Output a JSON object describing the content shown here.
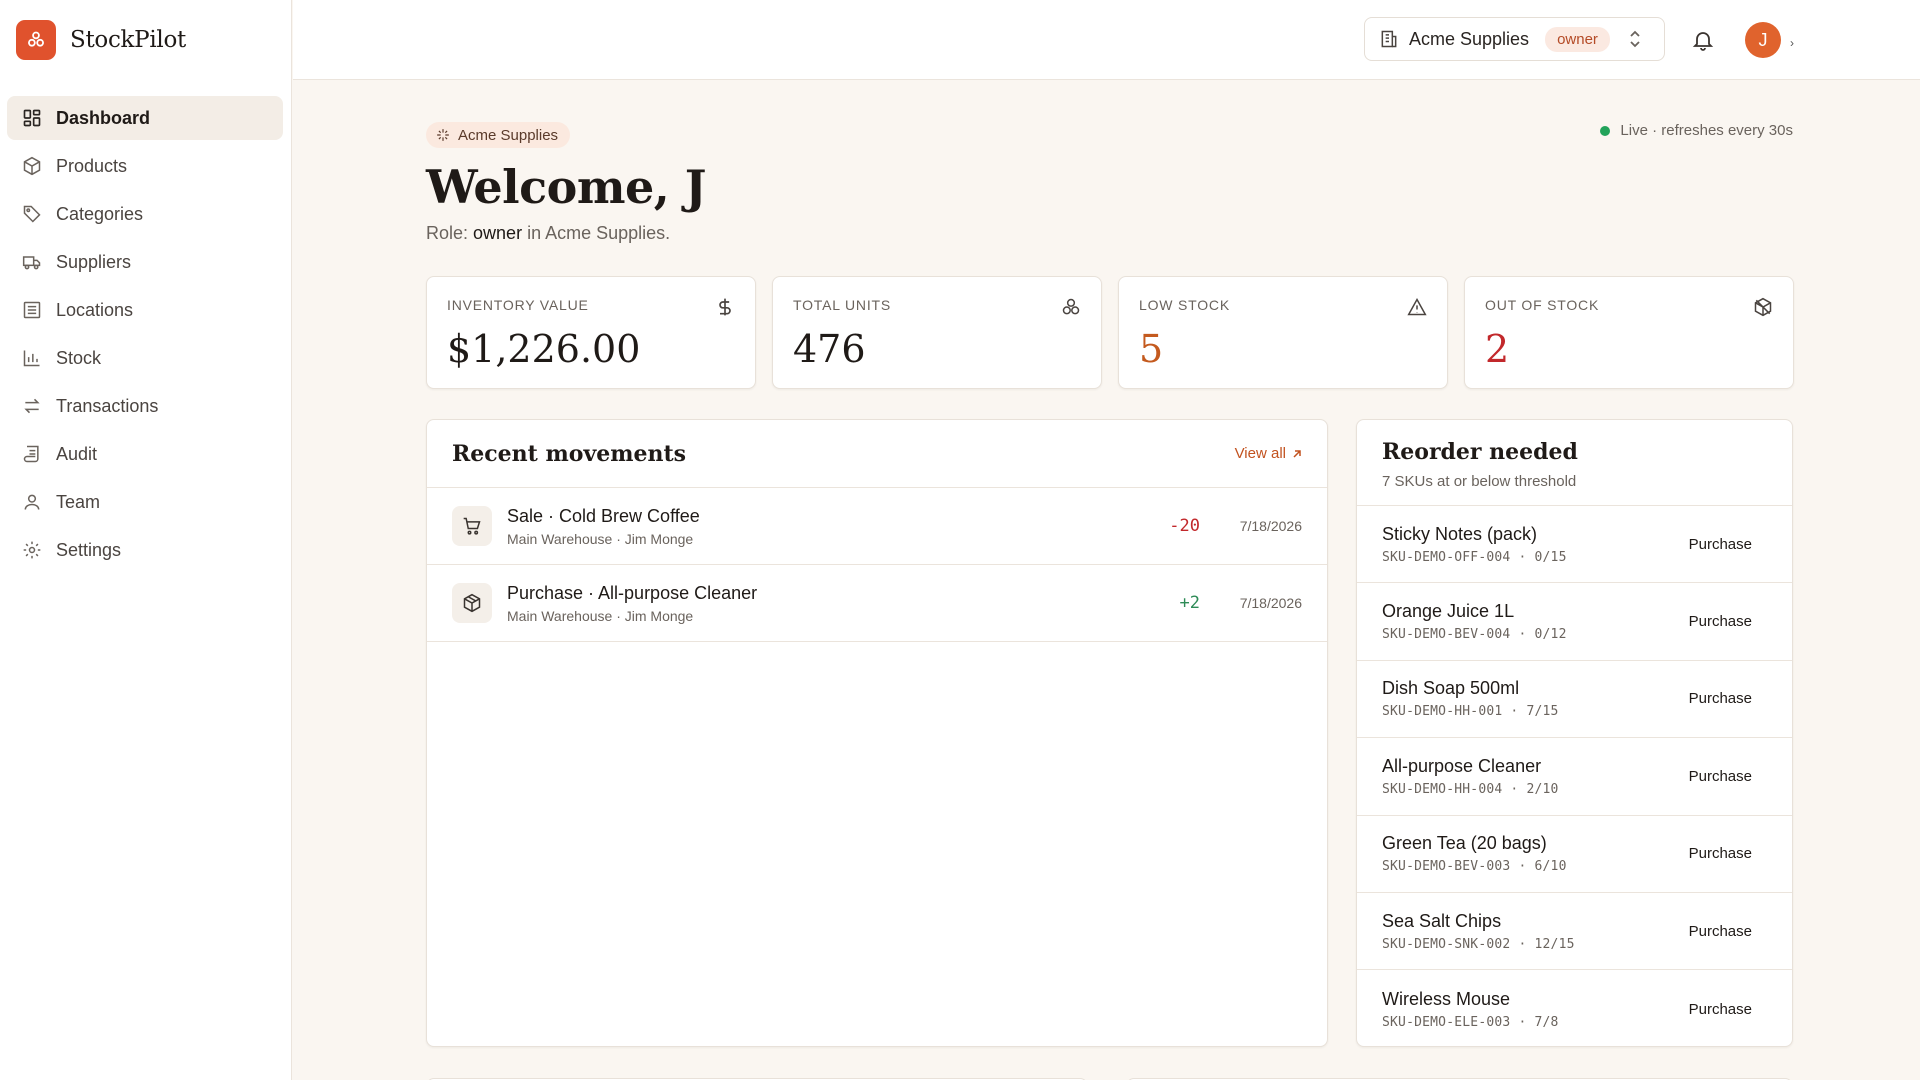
{
  "app": {
    "name": "StockPilot"
  },
  "sidebar": {
    "items": [
      {
        "label": "Dashboard",
        "icon": "dashboard-icon",
        "active": true
      },
      {
        "label": "Products",
        "icon": "box-icon"
      },
      {
        "label": "Categories",
        "icon": "tag-icon"
      },
      {
        "label": "Suppliers",
        "icon": "truck-icon"
      },
      {
        "label": "Locations",
        "icon": "building-icon"
      },
      {
        "label": "Stock",
        "icon": "bar-chart-icon"
      },
      {
        "label": "Transactions",
        "icon": "arrows-icon"
      },
      {
        "label": "Audit",
        "icon": "scroll-icon"
      },
      {
        "label": "Team",
        "icon": "user-icon"
      },
      {
        "label": "Settings",
        "icon": "gear-icon"
      }
    ]
  },
  "topbar": {
    "org_name": "Acme Supplies",
    "role": "owner",
    "avatar_initial": "J"
  },
  "header": {
    "org_chip": "Acme Supplies",
    "live_status": "Live · refreshes every 30s",
    "welcome": "Welcome, J",
    "role_prefix": "Role: ",
    "role": "owner",
    "role_suffix": " in Acme Supplies."
  },
  "stats": [
    {
      "label": "INVENTORY VALUE",
      "value": "$1,226.00",
      "icon": "dollar-icon"
    },
    {
      "label": "TOTAL UNITS",
      "value": "476",
      "icon": "boxes-icon"
    },
    {
      "label": "LOW STOCK",
      "value": "5",
      "icon": "warning-icon"
    },
    {
      "label": "OUT OF STOCK",
      "value": "2",
      "icon": "box-off-icon"
    }
  ],
  "movements": {
    "title": "Recent movements",
    "view_all": "View all",
    "rows": [
      {
        "title": "Sale · Cold Brew Coffee",
        "sub": "Main Warehouse · Jim Monge",
        "qty": "-20",
        "date": "7/18/2026",
        "icon": "cart-icon"
      },
      {
        "title": "Purchase · All-purpose Cleaner",
        "sub": "Main Warehouse · Jim Monge",
        "qty": "+2",
        "date": "7/18/2026",
        "icon": "package-icon"
      }
    ]
  },
  "reorder": {
    "title": "Reorder needed",
    "subtitle": "7 SKUs at or below threshold",
    "button_label": "Purchase",
    "rows": [
      {
        "name": "Sticky Notes (pack)",
        "sku": "SKU-DEMO-OFF-004 · 0/15"
      },
      {
        "name": "Orange Juice 1L",
        "sku": "SKU-DEMO-BEV-004 · 0/12"
      },
      {
        "name": "Dish Soap 500ml",
        "sku": "SKU-DEMO-HH-001 · 7/15"
      },
      {
        "name": "All-purpose Cleaner",
        "sku": "SKU-DEMO-HH-004 · 2/10"
      },
      {
        "name": "Green Tea (20 bags)",
        "sku": "SKU-DEMO-BEV-003 · 6/10"
      },
      {
        "name": "Sea Salt Chips",
        "sku": "SKU-DEMO-SNK-002 · 12/15"
      },
      {
        "name": "Wireless Mouse",
        "sku": "SKU-DEMO-ELE-003 · 7/8"
      }
    ]
  },
  "colors": {
    "accent": "#e0522d",
    "danger": "#c2282b",
    "warning": "#c45a1e",
    "success": "#2e8b57",
    "live": "#22a35a"
  }
}
